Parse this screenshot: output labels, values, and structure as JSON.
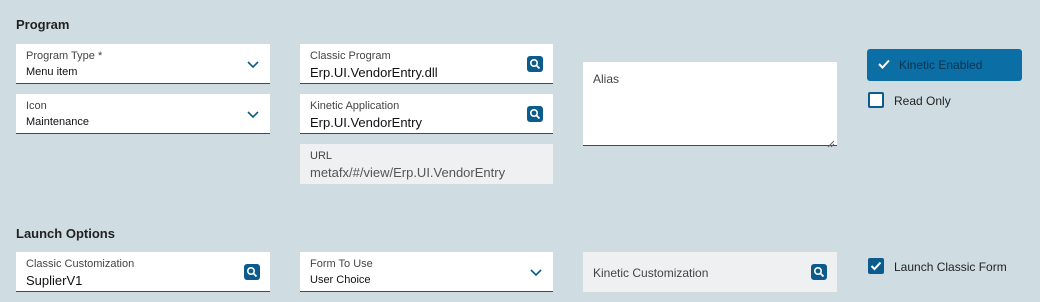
{
  "program": {
    "title": "Program",
    "program_type": {
      "label": "Program Type *",
      "value": "Menu item"
    },
    "icon_field": {
      "label": "Icon",
      "value": "Maintenance"
    },
    "classic_program": {
      "label": "Classic Program",
      "value": "Erp.UI.VendorEntry.dll"
    },
    "kinetic_application": {
      "label": "Kinetic Application",
      "value": "Erp.UI.VendorEntry"
    },
    "url": {
      "label": "URL",
      "value": "metafx/#/view/Erp.UI.VendorEntry"
    },
    "alias": {
      "placeholder": "Alias"
    },
    "kinetic_enabled": {
      "label": "Kinetic Enabled"
    },
    "read_only": {
      "label": "Read Only",
      "checked": false
    }
  },
  "launch": {
    "title": "Launch Options",
    "classic_customization": {
      "label": "Classic Customization",
      "value": "SuplierV1"
    },
    "form_to_use": {
      "label": "Form To Use",
      "value": "User Choice"
    },
    "kinetic_customization": {
      "placeholder": "Kinetic Customization"
    },
    "launch_classic_form": {
      "label": "Launch Classic Form",
      "checked": true
    }
  },
  "colors": {
    "background": "#cfdde2",
    "accent": "#0b5c8c",
    "button": "#0b6ea5"
  }
}
